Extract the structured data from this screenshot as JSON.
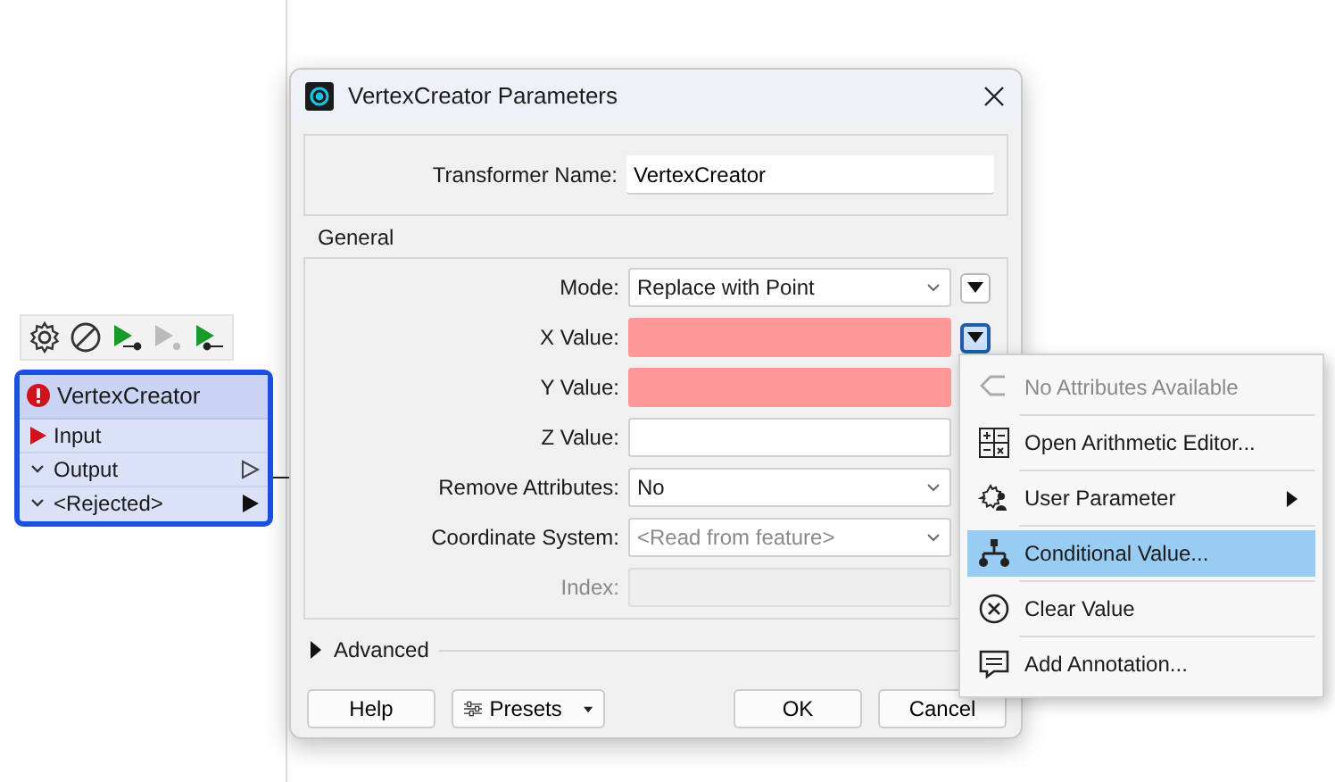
{
  "node": {
    "title": "VertexCreator",
    "error": true,
    "selected": true,
    "ports": [
      {
        "label": "Input",
        "kind": "input",
        "connected": false
      },
      {
        "label": "Output",
        "kind": "output",
        "connected": false
      },
      {
        "label": "<Rejected>",
        "kind": "output",
        "connected": true
      }
    ]
  },
  "dialog": {
    "title": "VertexCreator Parameters",
    "transformer_name": {
      "label": "Transformer Name:",
      "value": "VertexCreator"
    },
    "general": {
      "title": "General",
      "fields": [
        {
          "label": "Mode:",
          "kind": "select",
          "value": "Replace with Point",
          "menu_open": false
        },
        {
          "label": "X Value:",
          "kind": "text",
          "invalid": true,
          "menu_open": true
        },
        {
          "label": "Y Value:",
          "kind": "text",
          "invalid": true
        },
        {
          "label": "Z Value:",
          "kind": "text",
          "invalid": false
        },
        {
          "label": "Remove Attributes:",
          "kind": "select",
          "value": "No"
        },
        {
          "label": "Coordinate System:",
          "kind": "select",
          "placeholder": "<Read from feature>"
        },
        {
          "label": "Index:",
          "kind": "disabled"
        }
      ]
    },
    "advanced": {
      "label": "Advanced",
      "expanded": false
    },
    "buttons": [
      {
        "label": "Help",
        "kind": "plain"
      },
      {
        "label": "Presets",
        "kind": "presets"
      },
      {
        "label": "OK",
        "kind": "plain"
      },
      {
        "label": "Cancel",
        "kind": "plain"
      }
    ]
  },
  "menu": {
    "items": [
      {
        "label": "No Attributes Available",
        "kind": "attribute",
        "disabled": true,
        "selected": false,
        "submenu": false
      },
      {
        "label": "Open Arithmetic Editor...",
        "kind": "arithmetic",
        "disabled": false,
        "selected": false,
        "submenu": false
      },
      {
        "label": "User Parameter",
        "kind": "parameter",
        "disabled": false,
        "selected": false,
        "submenu": true
      },
      {
        "label": "Conditional Value...",
        "kind": "conditional",
        "disabled": false,
        "selected": true,
        "submenu": false
      },
      {
        "label": "Clear Value",
        "kind": "clear",
        "disabled": false,
        "selected": false,
        "submenu": false
      },
      {
        "label": "Add Annotation...",
        "kind": "annotation",
        "disabled": false,
        "selected": false,
        "submenu": false
      }
    ]
  }
}
